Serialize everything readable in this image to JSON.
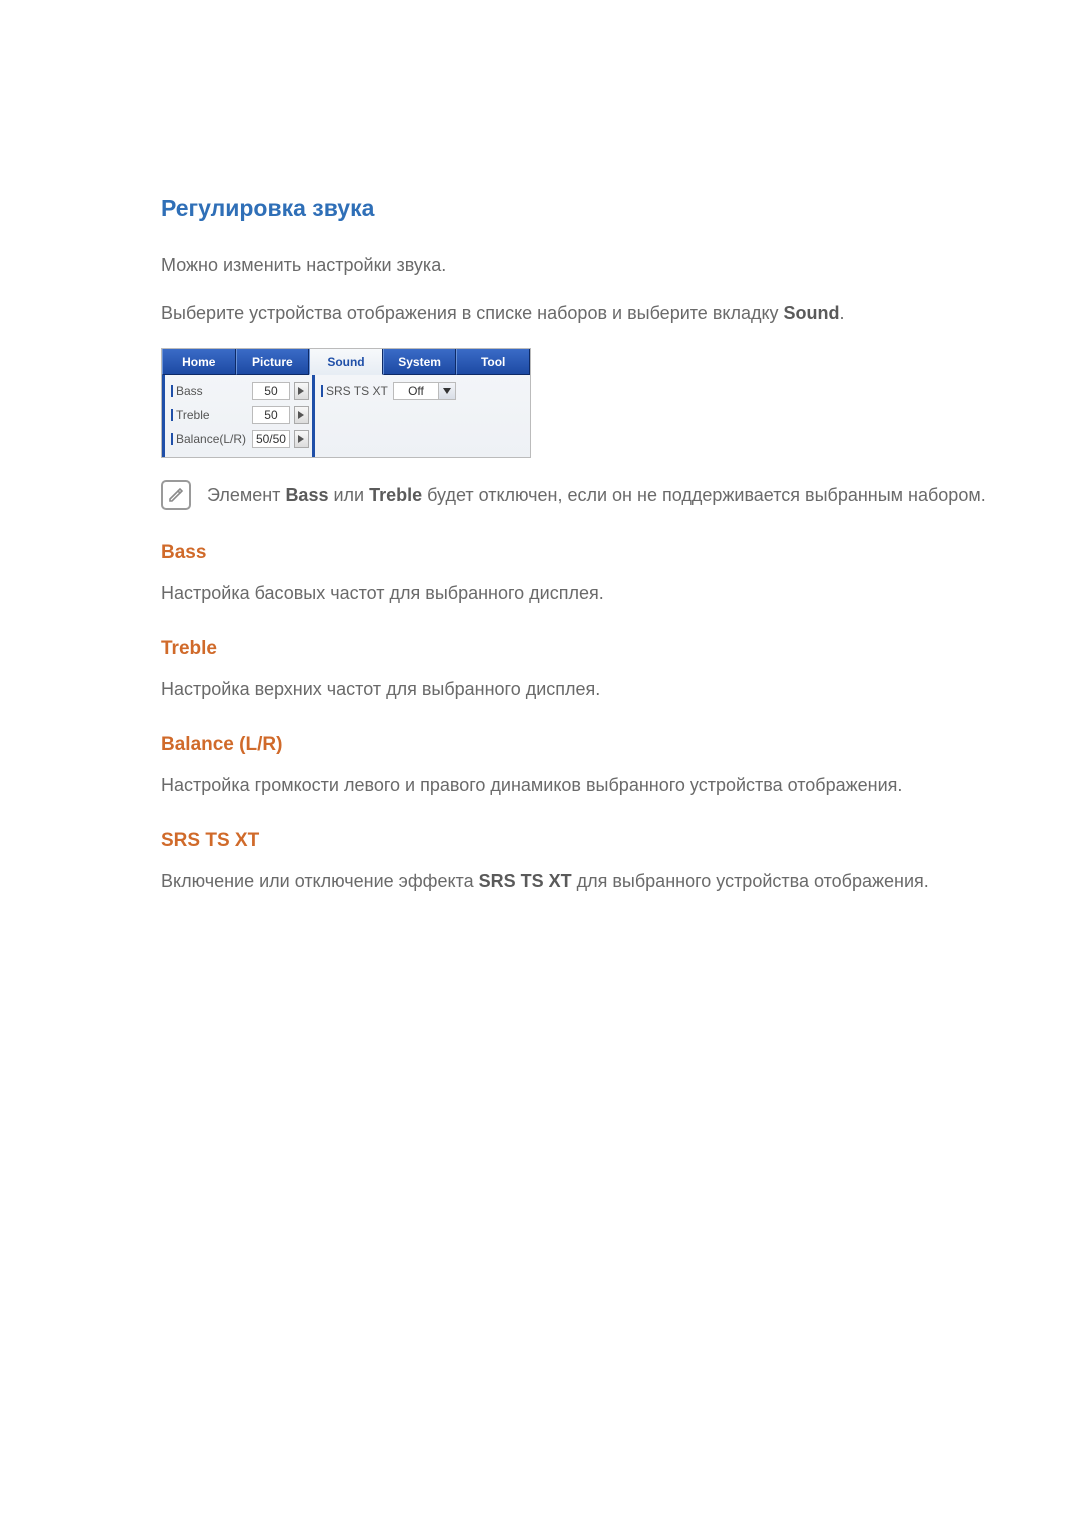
{
  "section_title": "Регулировка звука",
  "intro1": "Можно изменить настройки звука.",
  "intro2_prefix": "Выберите устройства отображения в списке наборов и выберите вкладку ",
  "intro2_bold": "Sound",
  "intro2_suffix": ".",
  "ui": {
    "tabs": {
      "home": "Home",
      "picture": "Picture",
      "sound": "Sound",
      "system": "System",
      "tool": "Tool"
    },
    "rows": {
      "bass_label": "Bass",
      "bass_value": "50",
      "treble_label": "Treble",
      "treble_value": "50",
      "balance_label": "Balance(L/R)",
      "balance_value": "50/50",
      "srs_label": "SRS TS XT",
      "srs_value": "Off"
    }
  },
  "note_prefix": "Элемент ",
  "note_bold1": "Bass",
  "note_mid": " или ",
  "note_bold2": "Treble",
  "note_suffix": " будет отключен, если он не поддерживается выбранным набором.",
  "bass_h": "Bass",
  "bass_p": "Настройка басовых частот для выбранного дисплея.",
  "treble_h": "Treble",
  "treble_p": "Настройка верхних частот для выбранного дисплея.",
  "balance_h": "Balance (L/R)",
  "balance_p": "Настройка громкости левого и правого динамиков выбранного устройства отображения.",
  "srs_h": "SRS TS XT",
  "srs_p_prefix": "Включение или отключение эффекта ",
  "srs_p_bold": "SRS TS XT",
  "srs_p_suffix": " для выбранного устройства отображения."
}
